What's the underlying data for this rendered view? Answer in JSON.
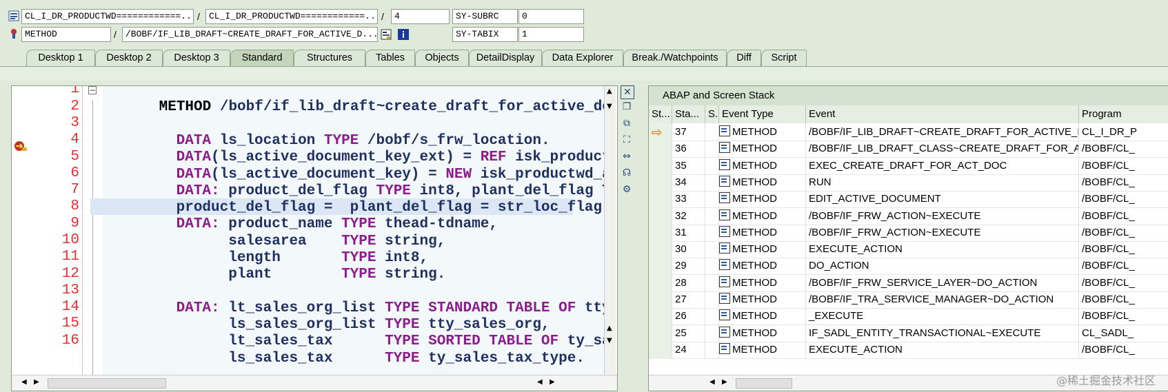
{
  "header": {
    "row1": {
      "program": "CL_I_DR_PRODUCTWD============...",
      "include": "CL_I_DR_PRODUCTWD============...",
      "line": "4",
      "sy_label": "SY-SUBRC",
      "sy_value": "0"
    },
    "row2": {
      "type": "METHOD",
      "method": "/BOBF/IF_LIB_DRAFT~CREATE_DRAFT_FOR_ACTIVE_D...",
      "sy_label": "SY-TABIX",
      "sy_value": "1"
    },
    "sep": "/"
  },
  "tabs": [
    "Desktop 1",
    "Desktop 2",
    "Desktop 3",
    "Standard",
    "Structures",
    "Tables",
    "Objects",
    "DetailDisplay",
    "Data Explorer",
    "Break./Watchpoints",
    "Diff",
    "Script"
  ],
  "active_tab": "Standard",
  "editor": {
    "lines": [
      {
        "n": "1"
      },
      {
        "n": "2"
      },
      {
        "n": "3"
      },
      {
        "n": "4"
      },
      {
        "n": "5"
      },
      {
        "n": "6"
      },
      {
        "n": "7"
      },
      {
        "n": "8"
      },
      {
        "n": "9"
      },
      {
        "n": "10"
      },
      {
        "n": "11"
      },
      {
        "n": "12"
      },
      {
        "n": "13"
      },
      {
        "n": "14"
      },
      {
        "n": "15"
      },
      {
        "n": "16"
      }
    ],
    "code": {
      "l1_kw": "METHOD",
      "l1_rest": " /bobf/if_lib_draft~create_draft_for_active_do",
      "l3_kw1": "DATA",
      "l3_a": " ls_location ",
      "l3_kw2": "TYPE",
      "l3_b": " /bobf/s_frw_location.",
      "l4_kw1": "DATA",
      "l4_a": "(ls_active_document_key_ext) = ",
      "l4_kw2": "REF",
      "l4_b": " isk_product",
      "l5_kw1": "DATA",
      "l5_a": "(ls_active_document_key) = ",
      "l5_kw2": "NEW",
      "l5_b": " isk_productwd_a",
      "l6_kw1": "DATA:",
      "l6_a": " product_del_flag ",
      "l6_kw2": "TYPE",
      "l6_b": " int8, plant_del_flag T",
      "l7_a": "product_del_flag =  plant_del_flag = str_loc_flag",
      "l8_kw1": "DATA:",
      "l8_a": " product_name ",
      "l8_kw2": "TYPE",
      "l8_b": " thead-tdname,",
      "l9_a": "      salesarea    ",
      "l9_kw": "TYPE",
      "l9_b": " string,",
      "l10_a": "      length       ",
      "l10_kw": "TYPE",
      "l10_b": " int8,",
      "l11_a": "      plant        ",
      "l11_kw": "TYPE",
      "l11_b": " string.",
      "l13_kw1": "DATA:",
      "l13_a": " lt_sales_org_list ",
      "l13_kw2": "TYPE STANDARD TABLE OF",
      "l13_b": " tty",
      "l14_a": "      ls_sales_org_list ",
      "l14_kw": "TYPE",
      "l14_b": " tty_sales_org,",
      "l15_a": "      lt_sales_tax      ",
      "l15_kw": "TYPE SORTED TABLE OF",
      "l15_b": " ty_sa",
      "l16_a": "      ls_sales_tax      ",
      "l16_kw": "TYPE",
      "l16_b": " ty_sales_tax_type."
    },
    "fold_symbol": "−"
  },
  "stack": {
    "title": "ABAP and Screen Stack",
    "columns": [
      "St...",
      "Sta...",
      "S..",
      "Event Type",
      "Event",
      "Program"
    ],
    "rows": [
      {
        "cur": true,
        "level": "37",
        "type": "METHOD",
        "event": "/BOBF/IF_LIB_DRAFT~CREATE_DRAFT_FOR_ACTIVE_DOC",
        "program": "CL_I_DR_P"
      },
      {
        "cur": false,
        "level": "36",
        "type": "METHOD",
        "event": "/BOBF/IF_LIB_DRAFT_CLASS~CREATE_DRAFT_FOR_ACTIVE...",
        "program": "/BOBF/CL_"
      },
      {
        "cur": false,
        "level": "35",
        "type": "METHOD",
        "event": "EXEC_CREATE_DRAFT_FOR_ACT_DOC",
        "program": "/BOBF/CL_"
      },
      {
        "cur": false,
        "level": "34",
        "type": "METHOD",
        "event": "RUN",
        "program": "/BOBF/CL_"
      },
      {
        "cur": false,
        "level": "33",
        "type": "METHOD",
        "event": "EDIT_ACTIVE_DOCUMENT",
        "program": "/BOBF/CL_"
      },
      {
        "cur": false,
        "level": "32",
        "type": "METHOD",
        "event": "/BOBF/IF_FRW_ACTION~EXECUTE",
        "program": "/BOBF/CL_"
      },
      {
        "cur": false,
        "level": "31",
        "type": "METHOD",
        "event": "/BOBF/IF_FRW_ACTION~EXECUTE",
        "program": "/BOBF/CL_"
      },
      {
        "cur": false,
        "level": "30",
        "type": "METHOD",
        "event": "EXECUTE_ACTION",
        "program": "/BOBF/CL_"
      },
      {
        "cur": false,
        "level": "29",
        "type": "METHOD",
        "event": "DO_ACTION",
        "program": "/BOBF/CL_"
      },
      {
        "cur": false,
        "level": "28",
        "type": "METHOD",
        "event": "/BOBF/IF_FRW_SERVICE_LAYER~DO_ACTION",
        "program": "/BOBF/CL_"
      },
      {
        "cur": false,
        "level": "27",
        "type": "METHOD",
        "event": "/BOBF/IF_TRA_SERVICE_MANAGER~DO_ACTION",
        "program": "/BOBF/CL_"
      },
      {
        "cur": false,
        "level": "26",
        "type": "METHOD",
        "event": "_EXECUTE",
        "program": "/BOBF/CL_"
      },
      {
        "cur": false,
        "level": "25",
        "type": "METHOD",
        "event": "IF_SADL_ENTITY_TRANSACTIONAL~EXECUTE",
        "program": "CL_SADL_"
      },
      {
        "cur": false,
        "level": "24",
        "type": "METHOD",
        "event": "EXECUTE_ACTION",
        "program": "/BOBF/CL_"
      }
    ],
    "arrow": "⇨"
  },
  "watermark": "@稀土掘金技术社区",
  "colors": {
    "keyword": "#8e1b8e",
    "line_number": "#e03030",
    "background": "#dfeadb"
  }
}
